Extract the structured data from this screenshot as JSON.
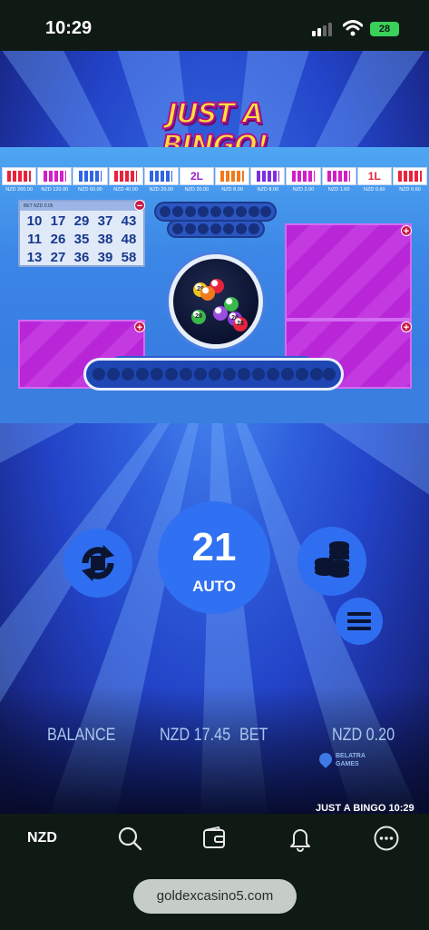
{
  "status_bar": {
    "time": "10:29",
    "battery": "28"
  },
  "game": {
    "logo_text": "JUST A BINGO!",
    "patterns": [
      {
        "prize": "NZD 200.00",
        "color": "#e8233c",
        "glyph": ""
      },
      {
        "prize": "NZD 120.00",
        "color": "#d21ec8",
        "glyph": ""
      },
      {
        "prize": "NZD 60.00",
        "color": "#2f64e4",
        "glyph": ""
      },
      {
        "prize": "NZD 40.00",
        "color": "#e8233c",
        "glyph": ""
      },
      {
        "prize": "NZD 20.00",
        "color": "#2f64e4",
        "glyph": ""
      },
      {
        "prize": "NZD 20.00",
        "color": "#9c1ec8",
        "glyph": "2L"
      },
      {
        "prize": "NZD 8.00",
        "color": "#f07a1e",
        "glyph": ""
      },
      {
        "prize": "NZD 8.00",
        "color": "#7a2ee0",
        "glyph": ""
      },
      {
        "prize": "NZD 2.00",
        "color": "#d21ec8",
        "glyph": ""
      },
      {
        "prize": "NZD 1.60",
        "color": "#d21ec8",
        "glyph": ""
      },
      {
        "prize": "NZD 0.60",
        "color": "#e8233c",
        "glyph": "1L"
      },
      {
        "prize": "NZD 0.60",
        "color": "#e8233c",
        "glyph": ""
      }
    ],
    "card": {
      "bet_label": "BET",
      "bet_value": "NZD 0.05",
      "card_number": "#1",
      "rows": [
        [
          "10",
          "17",
          "29",
          "37",
          "43"
        ],
        [
          "11",
          "26",
          "35",
          "38",
          "48"
        ],
        [
          "13",
          "27",
          "36",
          "39",
          "58"
        ]
      ]
    },
    "drum_balls": [
      {
        "number": "29",
        "color": "#f0c21e"
      },
      {
        "number": "",
        "color": "#e8233c"
      },
      {
        "number": "",
        "color": "#f07a1e"
      },
      {
        "number": "29",
        "color": "#3ab84a"
      },
      {
        "number": "",
        "color": "#9c4ee0"
      },
      {
        "number": "20",
        "color": "#8a3ed8"
      },
      {
        "number": "",
        "color": "#3ab84a"
      },
      {
        "number": "28",
        "color": "#e8233c"
      }
    ],
    "auto_button": {
      "count": "21",
      "label": "AUTO"
    },
    "balance_label": "BALANCE",
    "balance_value": "NZD 17.45",
    "bet_label": "BET",
    "bet_value": "NZD 0.20",
    "provider": "BELATRA GAMES",
    "title_time": "JUST A BINGO 10:29"
  },
  "nav": {
    "currency": "NZD"
  },
  "browser": {
    "url": "goldexcasino5.com"
  },
  "colors": {
    "accent_blue": "#3070f2",
    "card_purple": "#b826d8",
    "status_bg": "#0f1a14"
  }
}
